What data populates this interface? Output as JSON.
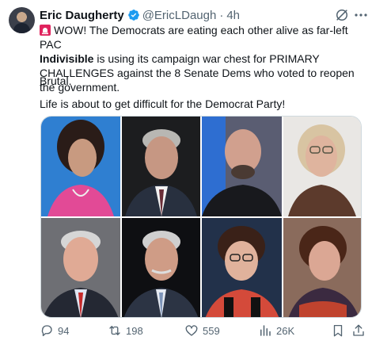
{
  "tweet": {
    "author_name": "Eric Daugherty",
    "handle": "@EricLDaugh",
    "separator": "·",
    "time": "4h",
    "text_line1_rest": "WOW! The Democrats are eating each other alive as far-left PAC",
    "text_bold": "Indivisible",
    "text_line2_rest": " is using its campaign war chest for PRIMARY CHALLENGES against the 8 Senate Dems who voted to reopen the government.",
    "text_para2": "Brutal.",
    "text_para3": "Life is about to get difficult for the Democrat Party!"
  },
  "icons": {
    "verified": "verified-badge-icon",
    "alarm": "rotating-light-icon",
    "grok": "grok-icon",
    "more": "more-icon",
    "reply": "reply-icon",
    "repost": "repost-icon",
    "like": "like-icon",
    "views": "views-icon",
    "bookmark": "bookmark-icon",
    "share": "share-icon"
  },
  "colors": {
    "verified": "#1d9bf0",
    "text": "#0f1419",
    "muted": "#536471",
    "alarm": "#e0245e"
  },
  "metrics": {
    "replies": "94",
    "reposts": "198",
    "likes": "559",
    "views": "26K"
  }
}
